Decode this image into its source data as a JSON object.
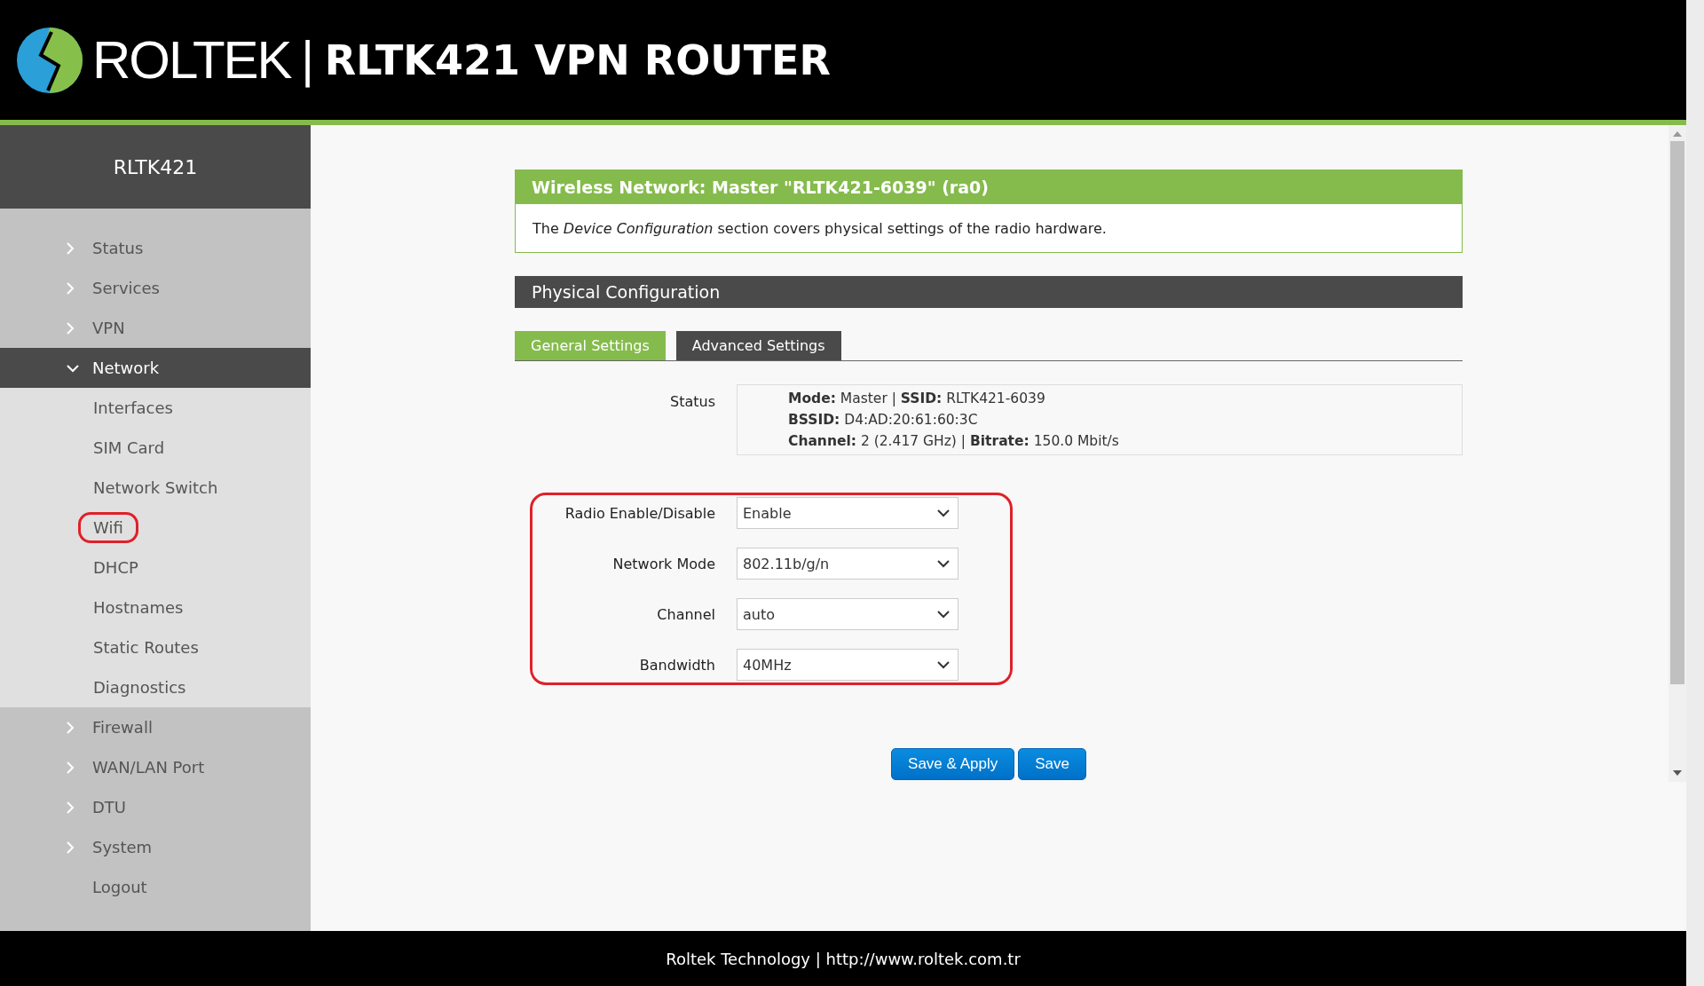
{
  "header": {
    "brand": "ROLTEK",
    "separator": "|",
    "product": "RLTK421 VPN ROUTER"
  },
  "sidebar": {
    "title": "RLTK421",
    "items": [
      {
        "label": "Status",
        "expanded": false
      },
      {
        "label": "Services",
        "expanded": false
      },
      {
        "label": "VPN",
        "expanded": false
      },
      {
        "label": "Network",
        "expanded": true,
        "children": [
          {
            "label": "Interfaces",
            "highlighted": false
          },
          {
            "label": "SIM Card",
            "highlighted": false
          },
          {
            "label": "Network Switch",
            "highlighted": false
          },
          {
            "label": "Wifi",
            "highlighted": true
          },
          {
            "label": "DHCP",
            "highlighted": false
          },
          {
            "label": "Hostnames",
            "highlighted": false
          },
          {
            "label": "Static Routes",
            "highlighted": false
          },
          {
            "label": "Diagnostics",
            "highlighted": false
          }
        ]
      },
      {
        "label": "Firewall",
        "expanded": false
      },
      {
        "label": "WAN/LAN Port",
        "expanded": false
      },
      {
        "label": "DTU",
        "expanded": false
      },
      {
        "label": "System",
        "expanded": false
      },
      {
        "label": "Logout"
      }
    ]
  },
  "section": {
    "title": "Wireless Network: Master \"RLTK421-6039\" (ra0)",
    "description": "The *Device Configuration* section covers physical settings of the radio hardware."
  },
  "physical": {
    "title": "Physical Configuration",
    "tabs": [
      {
        "label": "General Settings",
        "selected": true
      },
      {
        "label": "Advanced Settings",
        "selected": false
      }
    ],
    "status": {
      "label": "Status",
      "lines": [
        "**Mode:** Master | **SSID:** RLTK421-6039",
        "**BSSID:** D4:AD:20:61:60:3C",
        "**Channel:** 2 (2.417 GHz) | **Bitrate:** 150.0 Mbit/s"
      ]
    },
    "form": {
      "highlighted": true,
      "fields": [
        {
          "label": "Radio Enable/Disable",
          "value": "Enable"
        },
        {
          "label": "Network Mode",
          "value": "802.11b/g/n"
        },
        {
          "label": "Channel",
          "value": "auto"
        },
        {
          "label": "Bandwidth",
          "value": "40MHz"
        }
      ]
    }
  },
  "buttons": [
    "Save & Apply",
    "Save"
  ],
  "footer": {
    "text": "Roltek Technology | http://www.roltek.com.tr"
  }
}
